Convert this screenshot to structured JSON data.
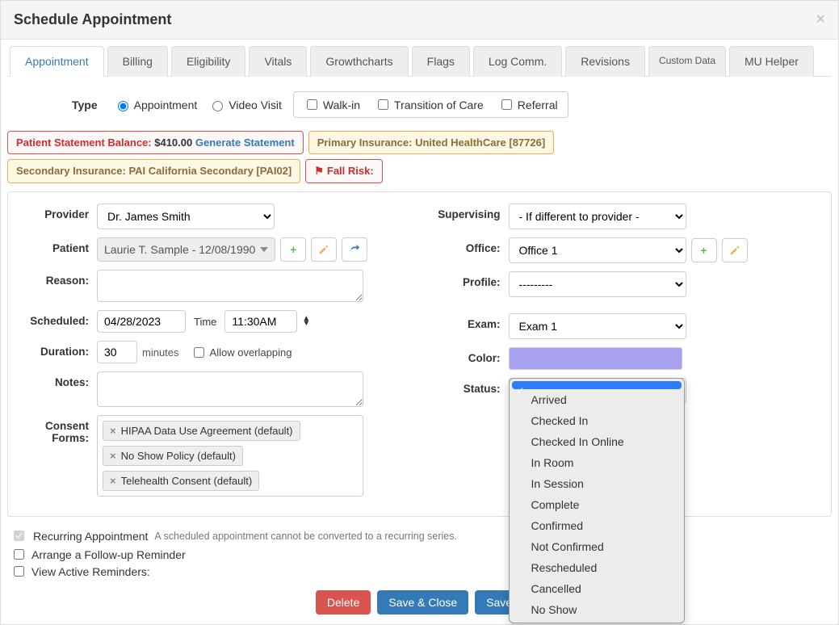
{
  "header": {
    "title": "Schedule Appointment"
  },
  "tabs": [
    "Appointment",
    "Billing",
    "Eligibility",
    "Vitals",
    "Growthcharts",
    "Flags",
    "Log Comm.",
    "Revisions",
    "Custom Data",
    "MU Helper"
  ],
  "type": {
    "label": "Type",
    "appointment": "Appointment",
    "video": "Video Visit",
    "walkin": "Walk-in",
    "transition": "Transition of Care",
    "referral": "Referral"
  },
  "badges": {
    "balance_label": "Patient Statement Balance:",
    "balance_amount": "$410.00",
    "generate": "Generate Statement",
    "primary": "Primary Insurance: United HealthCare [87726]",
    "secondary": "Secondary Insurance: PAI California Secondary [PAI02]",
    "fall": "Fall Risk:"
  },
  "labels": {
    "provider": "Provider",
    "patient": "Patient",
    "reason": "Reason:",
    "scheduled": "Scheduled:",
    "time": "Time",
    "duration": "Duration:",
    "minutes": "minutes",
    "overlap": "Allow overlapping",
    "notes": "Notes:",
    "consent": "Consent Forms:",
    "supervising": "Supervising",
    "office": "Office:",
    "profile": "Profile:",
    "exam": "Exam:",
    "color": "Color:",
    "status": "Status:"
  },
  "values": {
    "provider": "Dr. James Smith",
    "patient": "Laurie T. Sample - 12/08/1990",
    "date": "04/28/2023",
    "time": "11:30AM",
    "duration": "30",
    "supervising": "- If different to provider -",
    "office": "Office 1",
    "profile": "---------",
    "exam": "Exam 1",
    "color_hex": "#a9a1f2"
  },
  "consent": [
    "HIPAA Data Use Agreement (default)",
    "No Show Policy (default)",
    "Telehealth Consent (default)"
  ],
  "status_options": [
    "",
    "Arrived",
    "Checked In",
    "Checked In Online",
    "In Room",
    "In Session",
    "Complete",
    "Confirmed",
    "Not Confirmed",
    "Rescheduled",
    "Cancelled",
    "No Show"
  ],
  "bottom": {
    "recurring": "Recurring Appointment",
    "recurring_note": "A scheduled appointment cannot be converted to a recurring series.",
    "followup": "Arrange a Follow-up Reminder",
    "viewreminders": "View Active Reminders:"
  },
  "actions": {
    "delete": "Delete",
    "save_close": "Save & Close",
    "save": "Save"
  }
}
